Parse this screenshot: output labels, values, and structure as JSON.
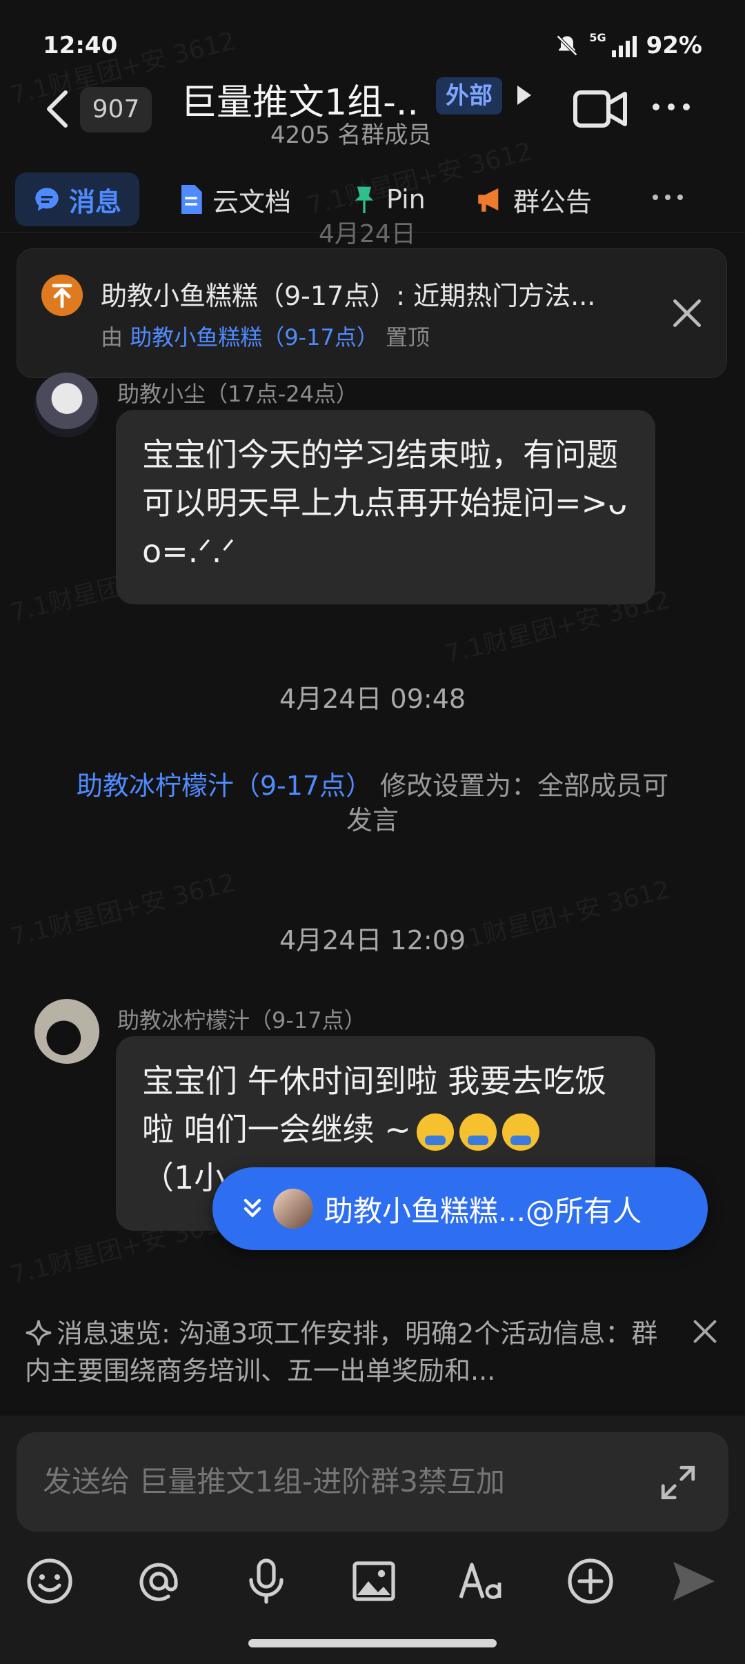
{
  "status_bar": {
    "time": "12:40",
    "network": "5G",
    "battery": "92%"
  },
  "header": {
    "unread_count": "907",
    "title": "巨量推文1组-...",
    "external_tag": "外部",
    "member_count": "4205 名群成员"
  },
  "tabs": [
    {
      "label": "消息",
      "icon": "message-icon",
      "active": true
    },
    {
      "label": "云文档",
      "icon": "doc-icon"
    },
    {
      "label": "Pin",
      "icon": "pin-icon"
    },
    {
      "label": "群公告",
      "icon": "announcement-icon"
    }
  ],
  "date_behind_tabs": "4月24日",
  "pinned": {
    "text": "助教小鱼糕糕（9-17点）: 近期热门方法...",
    "by_prefix": "由",
    "by_user": "助教小鱼糕糕（9-17点）",
    "by_suffix": "置顶"
  },
  "messages": [
    {
      "sender": "助教小尘（17点-24点）",
      "text": "宝宝们今天的学习结束啦，有问题可以明天早上九点再开始提问=>ᴗ o=.ᐟ.ᐟ"
    },
    {
      "sender": "助教冰柠檬汁（9-17点）",
      "text": "宝宝们 午休时间到啦 我要去吃饭啦 咱们一会继续 ~",
      "text_tail": "（1小"
    }
  ],
  "separators": {
    "time_1": "4月24日 09:48",
    "system_user": "助教冰柠檬汁（9-17点）",
    "system_text": " 修改设置为：全部成员可发言",
    "time_2": "4月24日 12:09"
  },
  "mention_pill": {
    "text": "助教小鱼糕糕...@所有人"
  },
  "summary": {
    "text": "消息速览: 沟通3项工作安排，明确2个活动信息：群内主要围绕商务培训、五一出单奖励和..."
  },
  "composer": {
    "placeholder": "发送给 巨量推文1组-进阶群3禁互加"
  },
  "watermark": "7.1财星团+安 3612",
  "colors": {
    "accent": "#4f8bff",
    "pill": "#2e6ef0",
    "background": "#121212",
    "bubble": "#2a2a2a"
  }
}
